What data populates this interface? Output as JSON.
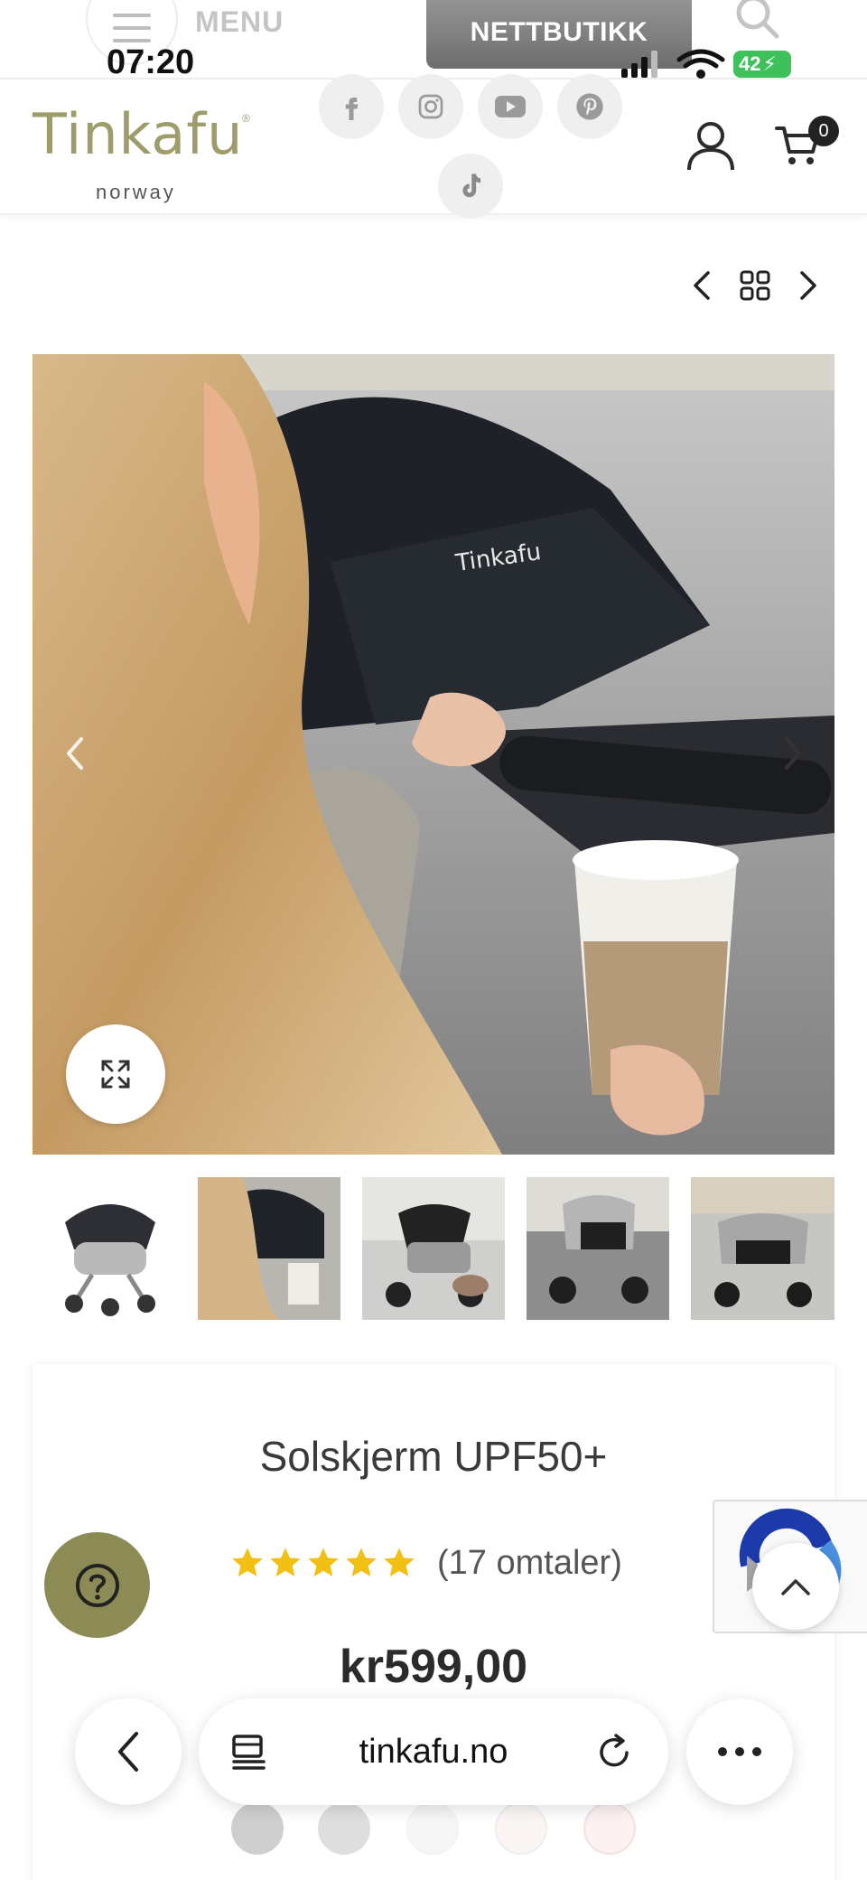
{
  "status_bar": {
    "time": "07:20",
    "battery": "42"
  },
  "topbar": {
    "menu_label": "MENU",
    "shop_label": "NETTBUTIKK"
  },
  "brand": {
    "logo_text": "Tinkafu",
    "logo_sub": "norway",
    "logo_reg": "®"
  },
  "header": {
    "cart_count": "0"
  },
  "social_icons": [
    "facebook-icon",
    "instagram-icon",
    "youtube-icon",
    "pinterest-icon",
    "tiktok-icon"
  ],
  "product": {
    "title": "Solskjerm UPF50+",
    "rating": 5,
    "reviews": "(17 omtaler)",
    "price": "kr599,00"
  },
  "browser": {
    "url": "tinkafu.no"
  },
  "colors": {
    "brand_olive": "#8d8b55",
    "star_yellow": "#f2c012",
    "battery_green": "#3ec05a"
  }
}
